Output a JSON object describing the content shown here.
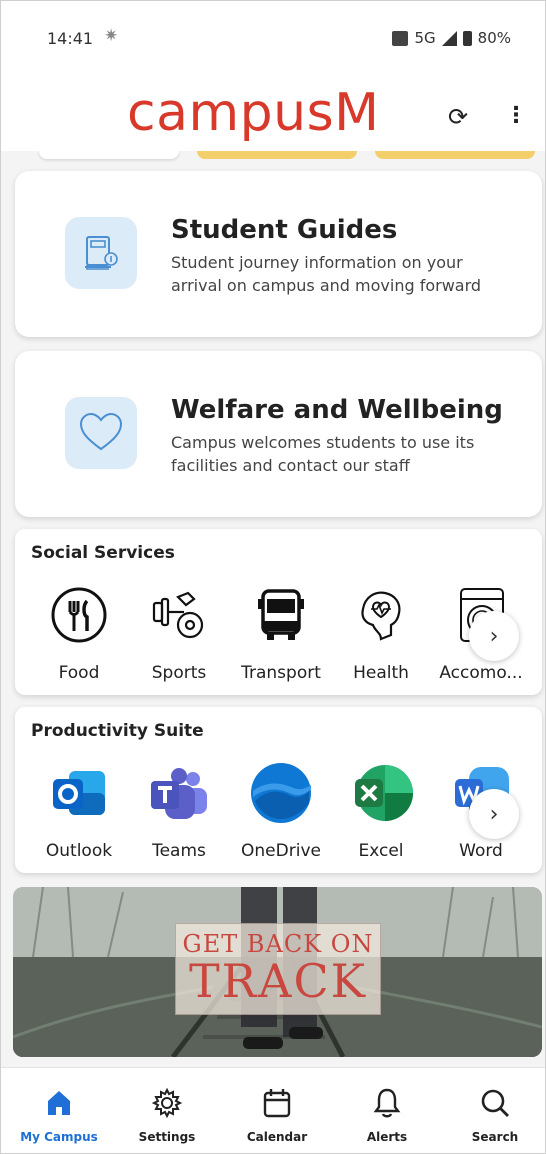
{
  "status_bar": {
    "time": "14:41",
    "network": "5G",
    "battery": "80%"
  },
  "header": {
    "app_name": "campusM"
  },
  "cards": [
    {
      "title": "Student Guides",
      "description": "Student journey information on your arrival on campus and moving forward",
      "icon": "book-icon"
    },
    {
      "title": "Welfare and Wellbeing",
      "description": "Campus welcomes students to use its facilities and contact our staff",
      "icon": "heart-icon"
    }
  ],
  "social_services": {
    "title": "Social Services",
    "items": [
      {
        "label": "Food",
        "icon": "food-icon"
      },
      {
        "label": "Sports",
        "icon": "dumbbell-icon"
      },
      {
        "label": "Transport",
        "icon": "bus-icon"
      },
      {
        "label": "Health",
        "icon": "health-icon"
      },
      {
        "label": "Accomo...",
        "icon": "washing-machine-icon"
      }
    ]
  },
  "productivity_suite": {
    "title": "Productivity Suite",
    "items": [
      {
        "label": "Outlook",
        "icon": "outlook-icon",
        "color": "#0a64c8"
      },
      {
        "label": "Teams",
        "icon": "teams-icon",
        "color": "#5b5fc7"
      },
      {
        "label": "OneDrive",
        "icon": "onedrive-icon",
        "color": "#0f78d4"
      },
      {
        "label": "Excel",
        "icon": "excel-icon",
        "color": "#1d7a43"
      },
      {
        "label": "Word",
        "icon": "word-icon",
        "color": "#2b6cd6"
      }
    ]
  },
  "banner": {
    "line1": "GET BACK ON",
    "line2": "TRACK"
  },
  "nav": [
    {
      "label": "My Campus",
      "icon": "home-icon",
      "active": true
    },
    {
      "label": "Settings",
      "icon": "gear-icon"
    },
    {
      "label": "Calendar",
      "icon": "calendar-icon"
    },
    {
      "label": "Alerts",
      "icon": "bell-icon"
    },
    {
      "label": "Search",
      "icon": "search-icon"
    }
  ],
  "colors": {
    "brand": "#d9392b",
    "active_nav": "#1f6fd6",
    "icon_bg": "#dcebf8"
  }
}
